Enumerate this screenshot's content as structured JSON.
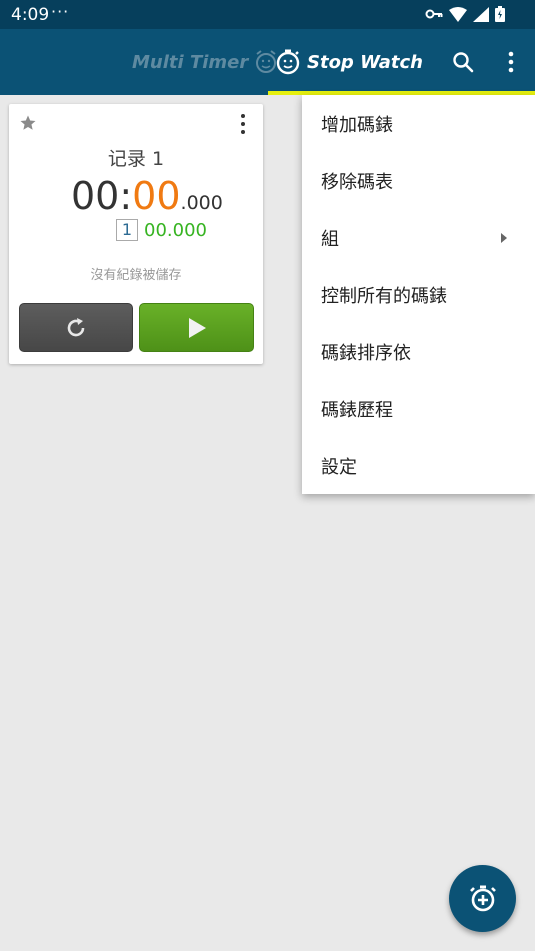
{
  "status_bar": {
    "time": "4:09",
    "dots": "···"
  },
  "app_bar": {
    "tabs": [
      {
        "label": "Multi Timer"
      },
      {
        "label": "Stop Watch"
      }
    ],
    "accent": "#e6f00f",
    "background": "#0b5275"
  },
  "card": {
    "record_name": "记录 1",
    "time_minutes": "00",
    "time_colon": ":",
    "time_seconds": "00",
    "time_millis": ".000",
    "lap_number": "1",
    "lap_time": "00.000",
    "empty_message": "沒有紀錄被儲存",
    "icons": [
      "star-icon",
      "more-vert-icon",
      "reset-icon",
      "play-icon"
    ]
  },
  "menu": {
    "items": [
      {
        "label": "增加碼錶"
      },
      {
        "label": "移除碼表"
      },
      {
        "label": "組"
      },
      {
        "label": "控制所有的碼錶"
      },
      {
        "label": "碼錶排序依"
      },
      {
        "label": "碼錶歷程"
      },
      {
        "label": "設定"
      }
    ]
  },
  "colors": {
    "seconds": "#f07a12",
    "lap": "#37b422",
    "play": "#5aa31f"
  }
}
